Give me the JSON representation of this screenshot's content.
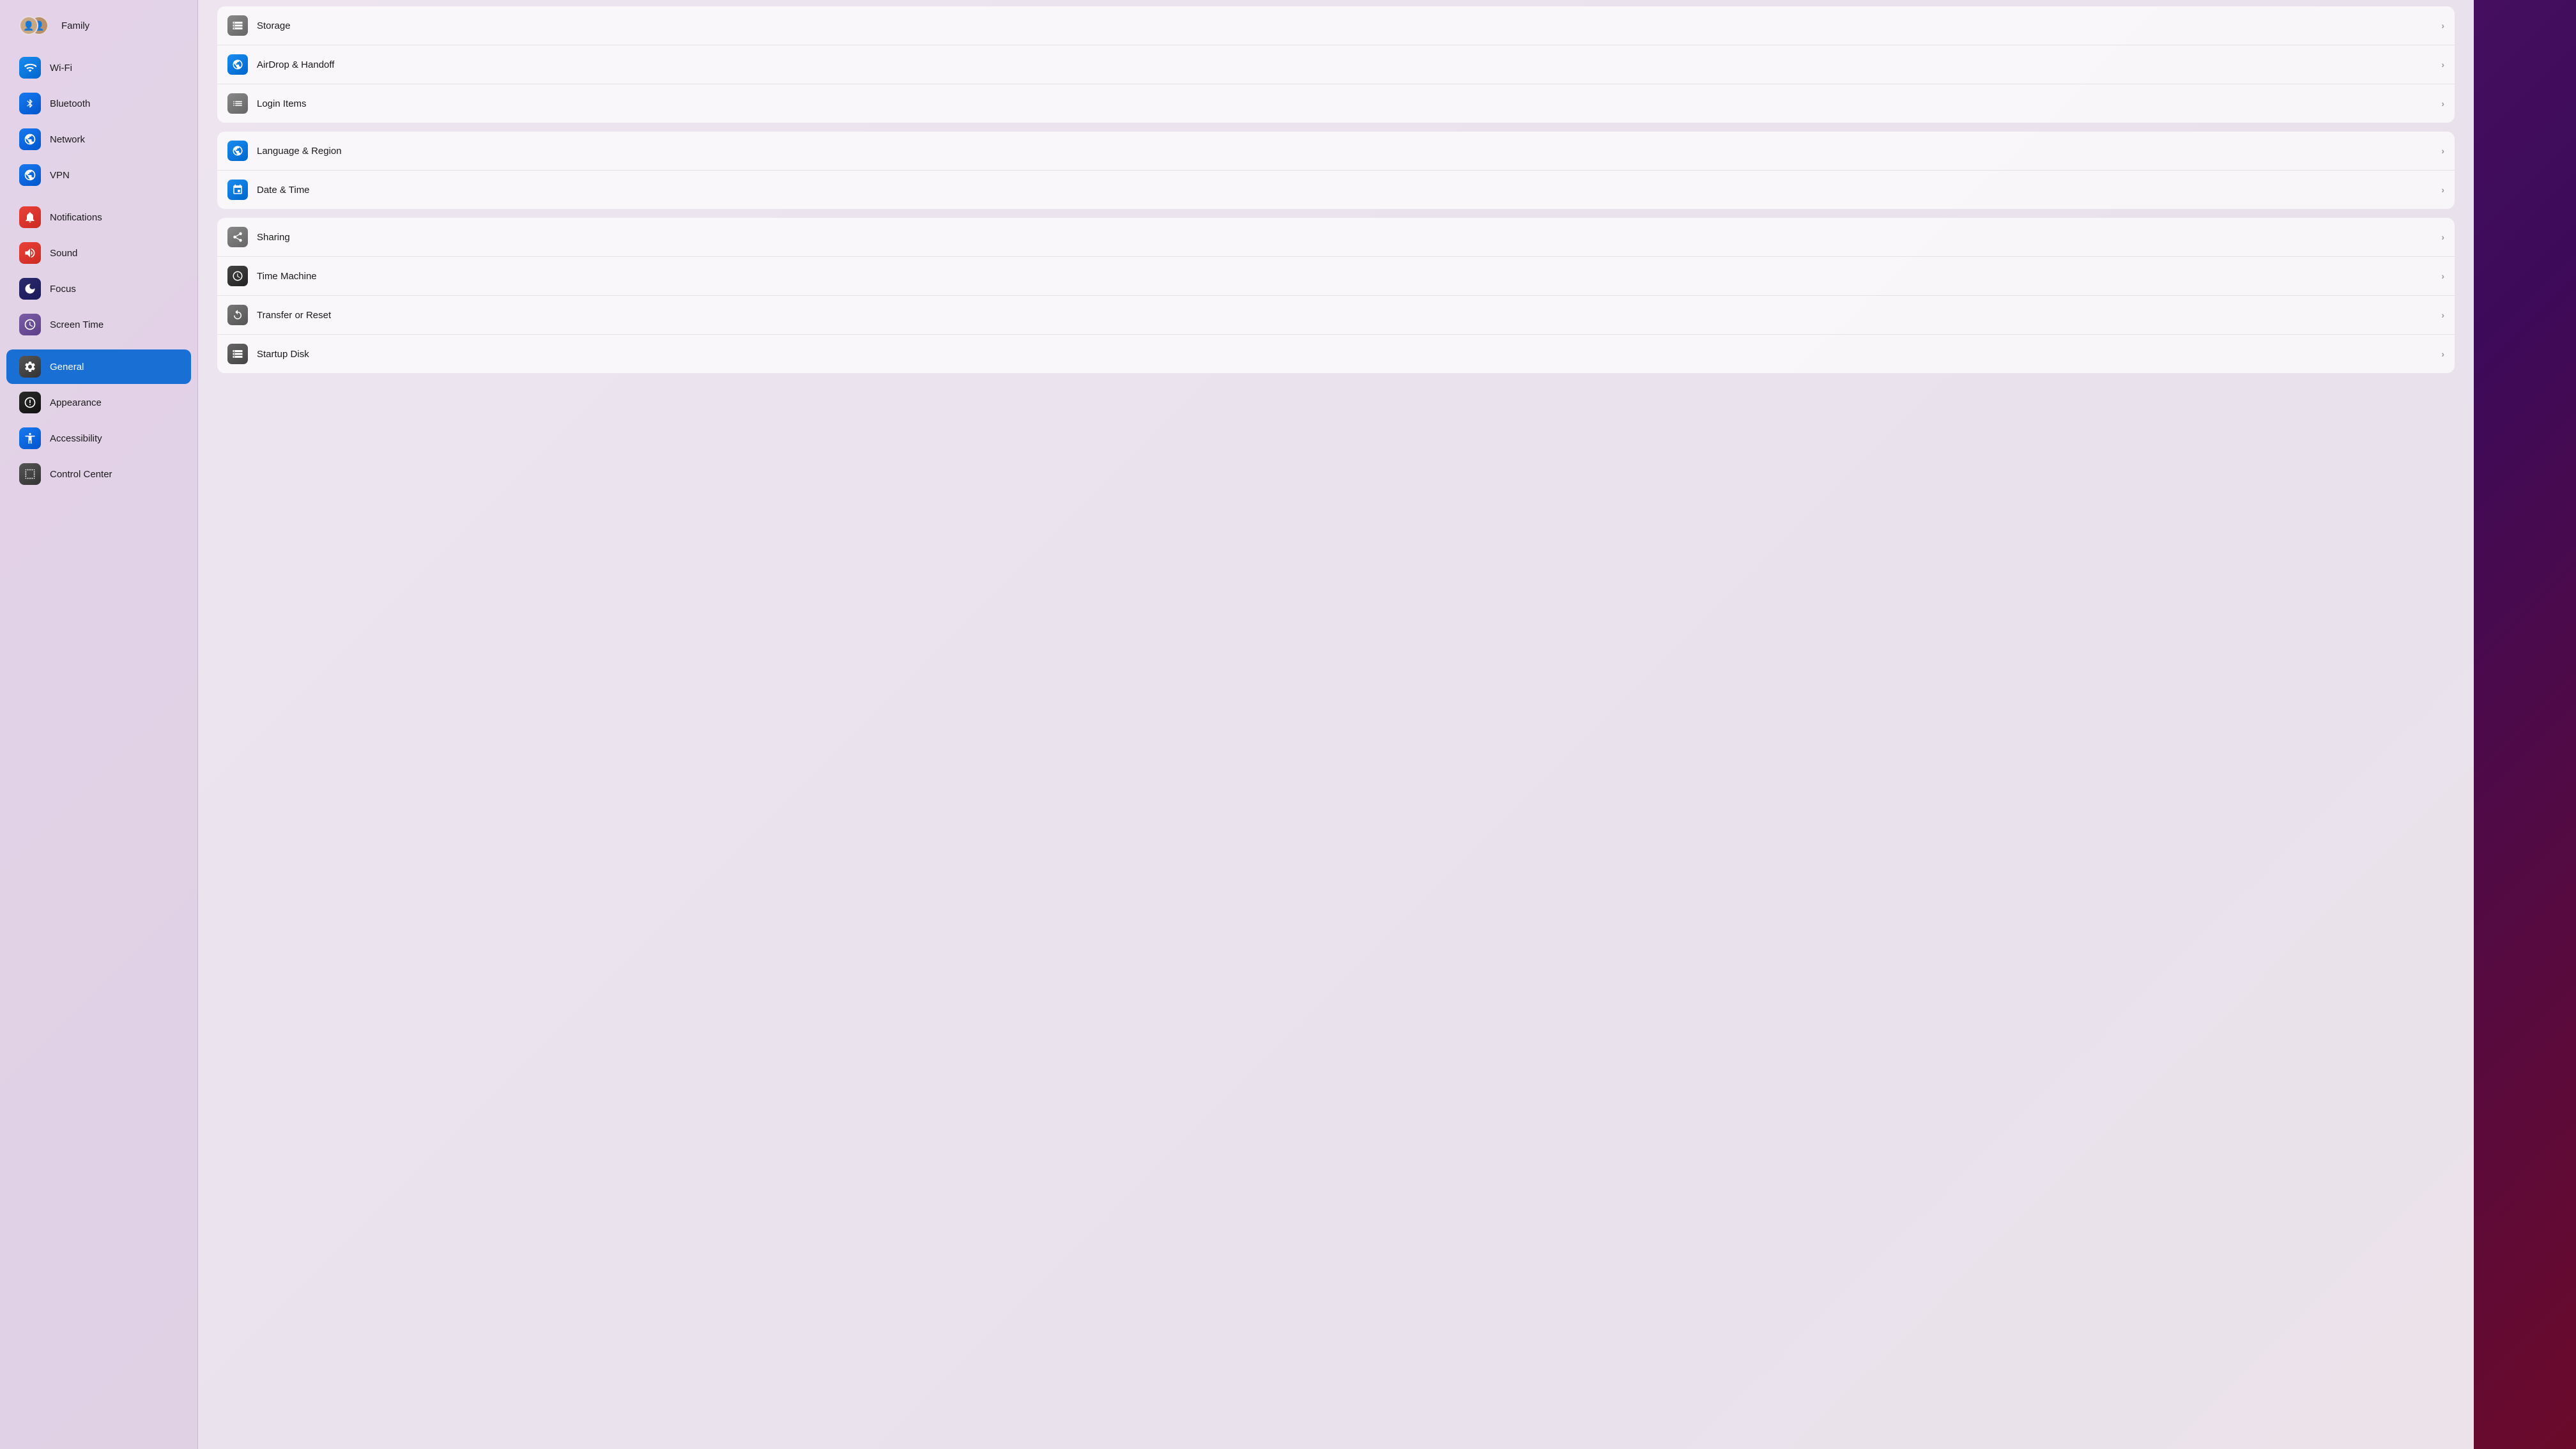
{
  "sidebar": {
    "family_label": "Family",
    "items": [
      {
        "id": "wifi",
        "label": "Wi-Fi",
        "icon_class": "icon-wifi",
        "icon_char": "📶"
      },
      {
        "id": "bluetooth",
        "label": "Bluetooth",
        "icon_class": "icon-bluetooth",
        "icon_char": "✦"
      },
      {
        "id": "network",
        "label": "Network",
        "icon_class": "icon-network",
        "icon_char": "🌐"
      },
      {
        "id": "vpn",
        "label": "VPN",
        "icon_class": "icon-vpn",
        "icon_char": "🌐"
      },
      {
        "id": "notifications",
        "label": "Notifications",
        "icon_class": "icon-notifications",
        "icon_char": "🔔"
      },
      {
        "id": "sound",
        "label": "Sound",
        "icon_class": "icon-sound",
        "icon_char": "🔊"
      },
      {
        "id": "focus",
        "label": "Focus",
        "icon_class": "icon-focus",
        "icon_char": "🌙"
      },
      {
        "id": "screentime",
        "label": "Screen Time",
        "icon_class": "icon-screentime",
        "icon_char": "⌛"
      },
      {
        "id": "general",
        "label": "General",
        "icon_class": "icon-general",
        "icon_char": "⚙"
      },
      {
        "id": "appearance",
        "label": "Appearance",
        "icon_class": "icon-appearance",
        "icon_char": "◑"
      },
      {
        "id": "accessibility",
        "label": "Accessibility",
        "icon_class": "icon-accessibility",
        "icon_char": "♿"
      },
      {
        "id": "controlcenter",
        "label": "Control Center",
        "icon_class": "icon-controlcenter",
        "icon_char": "⊞"
      }
    ]
  },
  "main": {
    "groups": [
      {
        "id": "group1",
        "rows": [
          {
            "id": "storage",
            "label": "Storage",
            "icon_class": "ci-storage",
            "icon_char": "🗄"
          },
          {
            "id": "airdrop",
            "label": "AirDrop & Handoff",
            "icon_class": "ci-airdrop",
            "icon_char": "📡"
          },
          {
            "id": "loginitems",
            "label": "Login Items",
            "icon_class": "ci-loginitems",
            "icon_char": "☰"
          }
        ]
      },
      {
        "id": "group2",
        "rows": [
          {
            "id": "language",
            "label": "Language & Region",
            "icon_class": "ci-language",
            "icon_char": "🌐"
          },
          {
            "id": "datetime",
            "label": "Date & Time",
            "icon_class": "ci-datetime",
            "icon_char": "📅"
          }
        ]
      },
      {
        "id": "group3",
        "rows": [
          {
            "id": "sharing",
            "label": "Sharing",
            "icon_class": "ci-sharing",
            "icon_char": "♻"
          },
          {
            "id": "timemachine",
            "label": "Time Machine",
            "icon_class": "ci-timemachine",
            "icon_char": "⏱"
          },
          {
            "id": "transfer",
            "label": "Transfer or Reset",
            "icon_class": "ci-transfer",
            "icon_char": "↺"
          },
          {
            "id": "startup",
            "label": "Startup Disk",
            "icon_class": "ci-startup",
            "icon_char": "💾"
          }
        ]
      }
    ]
  }
}
